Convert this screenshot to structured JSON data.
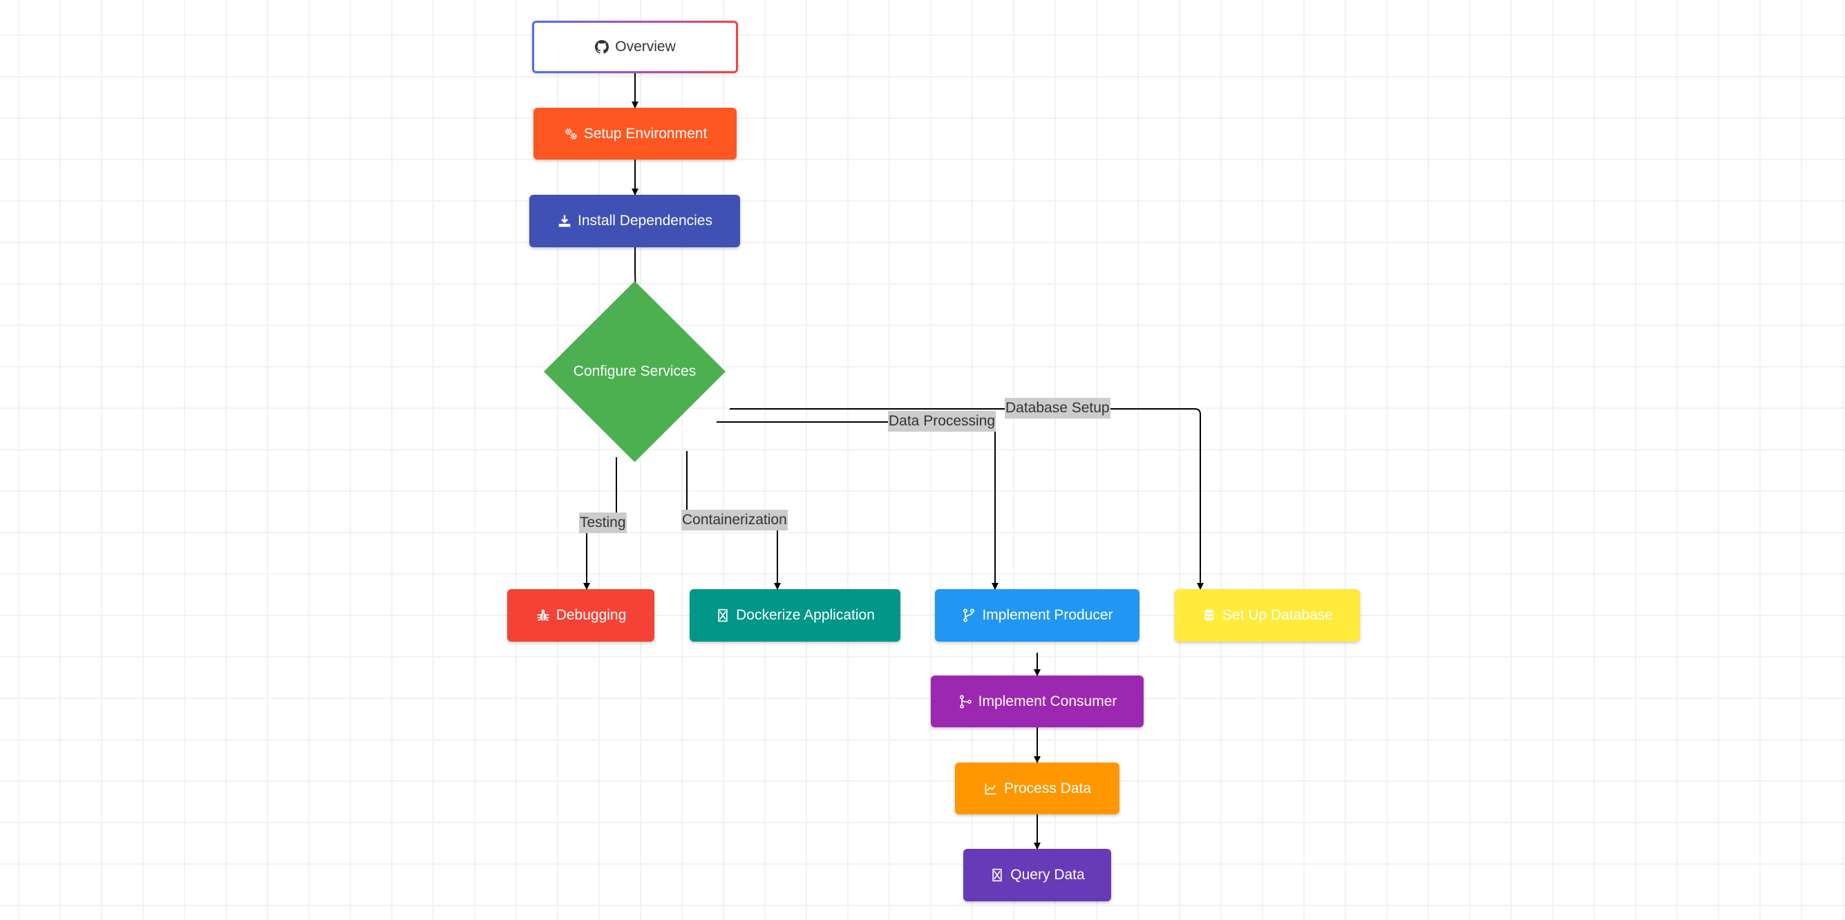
{
  "diagram": {
    "nodes": {
      "overview": {
        "label": "Overview",
        "icon": "github-icon"
      },
      "setup_env": {
        "label": "Setup Environment",
        "icon": "gears-icon",
        "color": "#FF5722"
      },
      "install_deps": {
        "label": "Install Dependencies",
        "icon": "download-icon",
        "color": "#3F51B5"
      },
      "configure": {
        "label": "Configure Services",
        "shape": "diamond",
        "color": "#4CAF50"
      },
      "debugging": {
        "label": "Debugging",
        "icon": "bug-icon",
        "color": "#F44336"
      },
      "dockerize": {
        "label": "Dockerize Application",
        "icon": "docker-icon",
        "color": "#009688"
      },
      "producer": {
        "label": "Implement Producer",
        "icon": "code-branch-icon",
        "color": "#2196F3"
      },
      "database": {
        "label": "Set Up Database",
        "icon": "database-icon",
        "color": "#FFEB3B"
      },
      "consumer": {
        "label": "Implement Consumer",
        "icon": "code-merge-icon",
        "color": "#9C27B0"
      },
      "process": {
        "label": "Process Data",
        "icon": "chart-line-icon",
        "color": "#FF9800"
      },
      "query": {
        "label": "Query Data",
        "icon": "query-icon",
        "color": "#673AB7"
      }
    },
    "edges": [
      {
        "from": "overview",
        "to": "setup_env",
        "label": ""
      },
      {
        "from": "setup_env",
        "to": "install_deps",
        "label": ""
      },
      {
        "from": "install_deps",
        "to": "configure",
        "label": ""
      },
      {
        "from": "configure",
        "to": "debugging",
        "label": "Testing"
      },
      {
        "from": "configure",
        "to": "dockerize",
        "label": "Containerization"
      },
      {
        "from": "configure",
        "to": "producer",
        "label": "Data Processing"
      },
      {
        "from": "configure",
        "to": "database",
        "label": "Database Setup"
      },
      {
        "from": "producer",
        "to": "consumer",
        "label": ""
      },
      {
        "from": "consumer",
        "to": "process",
        "label": ""
      },
      {
        "from": "process",
        "to": "query",
        "label": ""
      }
    ],
    "edge_labels": {
      "testing": "Testing",
      "containerization": "Containerization",
      "data_processing": "Data Processing",
      "database_setup": "Database Setup"
    }
  }
}
